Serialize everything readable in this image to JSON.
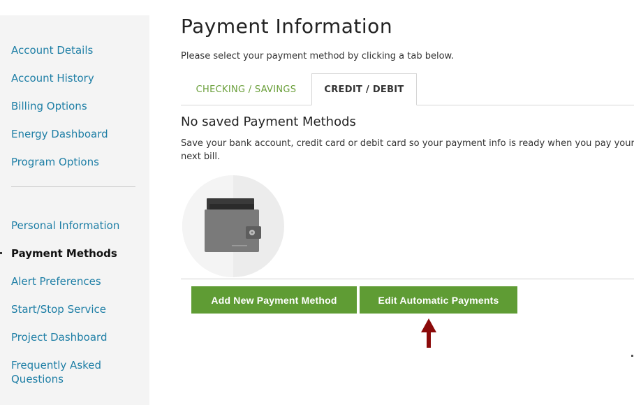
{
  "sidebar": {
    "items": [
      {
        "label": "Account Details",
        "active": false
      },
      {
        "label": "Account History",
        "active": false
      },
      {
        "label": "Billing Options",
        "active": false
      },
      {
        "label": "Energy Dashboard",
        "active": false
      },
      {
        "label": "Program Options",
        "active": false
      },
      {
        "label": "Personal Information",
        "active": false
      },
      {
        "label": "Payment Methods",
        "active": true
      },
      {
        "label": "Alert Preferences",
        "active": false
      },
      {
        "label": "Start/Stop Service",
        "active": false
      },
      {
        "label": "Project Dashboard",
        "active": false
      },
      {
        "label": "Frequently Asked Questions",
        "active": false
      }
    ]
  },
  "main": {
    "title": "Payment Information",
    "instruction": "Please select your payment method by clicking a tab below.",
    "tabs": [
      {
        "label": "CHECKING / SAVINGS",
        "active": false
      },
      {
        "label": "CREDIT / DEBIT",
        "active": true
      }
    ],
    "empty_state": {
      "heading": "No saved Payment Methods",
      "description": "Save your bank account, credit card or debit card so your payment info is ready when you pay your next bill."
    },
    "buttons": {
      "add": "Add New Payment Method",
      "edit": "Edit Automatic Payments"
    }
  },
  "colors": {
    "link": "#1f7fa6",
    "button": "#5f9c34",
    "tab_inactive": "#6a9f3a",
    "annotation_arrow": "#8b0a0a"
  },
  "icons": {
    "illustration": "wallet-icon",
    "annotation": "arrow-up-icon"
  }
}
